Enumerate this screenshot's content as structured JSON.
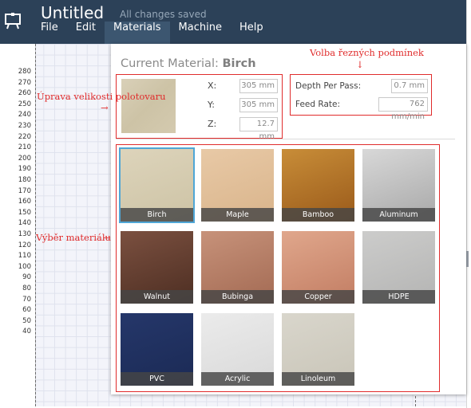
{
  "header": {
    "title": "Untitled",
    "save_status": "All changes saved"
  },
  "menu": {
    "items": [
      "File",
      "Edit",
      "Materials",
      "Machine",
      "Help"
    ],
    "active": "Materials"
  },
  "ruler": {
    "ticks": [
      "280",
      "270",
      "260",
      "250",
      "240",
      "230",
      "220",
      "210",
      "200",
      "190",
      "180",
      "170",
      "160",
      "150",
      "140",
      "130",
      "120",
      "110",
      "100",
      "90",
      "80",
      "70",
      "60",
      "50",
      "40"
    ]
  },
  "panel": {
    "title_prefix": "Current Material: ",
    "title_material": "Birch",
    "stock": {
      "x_label": "X:",
      "x_value": "305 mm",
      "y_label": "Y:",
      "y_value": "305 mm",
      "z_label": "Z:",
      "z_value": "12.7 mm"
    },
    "cutting": {
      "depth_label": "Depth Per Pass:",
      "depth_value": "0.7 mm",
      "feed_label": "Feed Rate:",
      "feed_value": "762 mm/min"
    },
    "materials": [
      {
        "name": "Birch",
        "colors": [
          "#ddd4bb",
          "#cdc3a5"
        ],
        "selected": true
      },
      {
        "name": "Maple",
        "colors": [
          "#e8c9a6",
          "#d9b48b"
        ],
        "selected": false
      },
      {
        "name": "Bamboo",
        "colors": [
          "#c88d38",
          "#9a5a1a"
        ],
        "selected": false
      },
      {
        "name": "Aluminum",
        "colors": [
          "#d8d8d8",
          "#a8a8a8"
        ],
        "selected": false
      },
      {
        "name": "Walnut",
        "colors": [
          "#7b5040",
          "#4d2e22"
        ],
        "selected": false
      },
      {
        "name": "Bubinga",
        "colors": [
          "#c7927a",
          "#a36a53"
        ],
        "selected": false
      },
      {
        "name": "Copper",
        "colors": [
          "#e0a78c",
          "#c27d63"
        ],
        "selected": false
      },
      {
        "name": "HDPE",
        "colors": [
          "#cccccb",
          "#b4b4b3"
        ],
        "selected": false
      },
      {
        "name": "PVC",
        "colors": [
          "#25376a",
          "#1b2a55"
        ],
        "selected": false
      },
      {
        "name": "Acrylic",
        "colors": [
          "#ebebeb",
          "#d9d9d9"
        ],
        "selected": false
      },
      {
        "name": "Linoleum",
        "colors": [
          "#d9d6cc",
          "#c9c5b8"
        ],
        "selected": false
      }
    ]
  },
  "annotations": {
    "stock_size": "Úprava velikosti polotovaru",
    "cutting_conditions": "Volba řezných podmínek",
    "material_choice": "Výběr materiálu"
  },
  "accent_colors": {
    "topbar": "#2c4158",
    "annotation": "#e02c2c",
    "selection": "#4fa6d6"
  }
}
